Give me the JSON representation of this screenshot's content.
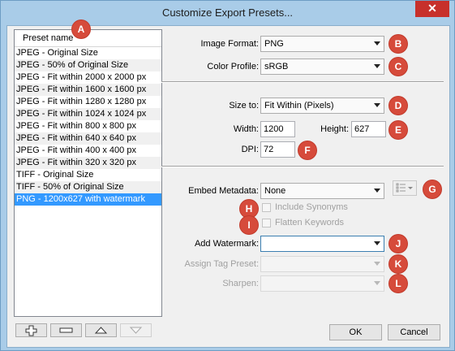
{
  "window": {
    "title": "Customize Export Presets...",
    "close_glyph": "✕"
  },
  "presets": {
    "header": "Preset name",
    "items": [
      "JPEG - Original Size",
      "JPEG - 50% of Original Size",
      "JPEG - Fit within 2000 x 2000 px",
      "JPEG - Fit within 1600 x 1600 px",
      "JPEG - Fit within 1280 x 1280 px",
      "JPEG - Fit within 1024 x 1024 px",
      "JPEG - Fit within 800 x 800 px",
      "JPEG - Fit within 640 x 640 px",
      "JPEG - Fit within 400 x 400 px",
      "JPEG - Fit within 320 x 320 px",
      "TIFF - Original Size",
      "TIFF - 50% of Original Size",
      "PNG - 1200x627 with watermark"
    ],
    "selected_index": 12,
    "buttons": {
      "add": "plus-icon",
      "remove": "minus-icon",
      "move_up": "triangle-up-icon",
      "move_down": "triangle-down-icon"
    }
  },
  "form": {
    "image_format": {
      "label": "Image Format:",
      "value": "PNG"
    },
    "color_profile": {
      "label": "Color Profile:",
      "value": "sRGB"
    },
    "size_to": {
      "label": "Size to:",
      "value": "Fit Within (Pixels)"
    },
    "width": {
      "label": "Width:",
      "value": "1200"
    },
    "height": {
      "label": "Height:",
      "value": "627"
    },
    "dpi": {
      "label": "DPI:",
      "value": "72"
    },
    "embed_metadata": {
      "label": "Embed Metadata:",
      "value": "None",
      "options_icon": "list-options-icon"
    },
    "include_synonyms": {
      "label": "Include Synonyms",
      "checked": false,
      "enabled": false
    },
    "flatten_keywords": {
      "label": "Flatten Keywords",
      "checked": false,
      "enabled": false
    },
    "add_watermark": {
      "label": "Add Watermark:",
      "value": ""
    },
    "assign_tag_preset": {
      "label": "Assign Tag Preset:",
      "value": "",
      "enabled": false
    },
    "sharpen": {
      "label": "Sharpen:",
      "value": "",
      "enabled": false
    }
  },
  "actions": {
    "ok": "OK",
    "cancel": "Cancel"
  },
  "badges": [
    "A",
    "B",
    "C",
    "D",
    "E",
    "F",
    "G",
    "H",
    "I",
    "J",
    "K",
    "L"
  ],
  "colors": {
    "badge": "#d64b3b",
    "selection": "#3399ff",
    "close": "#c7302b"
  }
}
